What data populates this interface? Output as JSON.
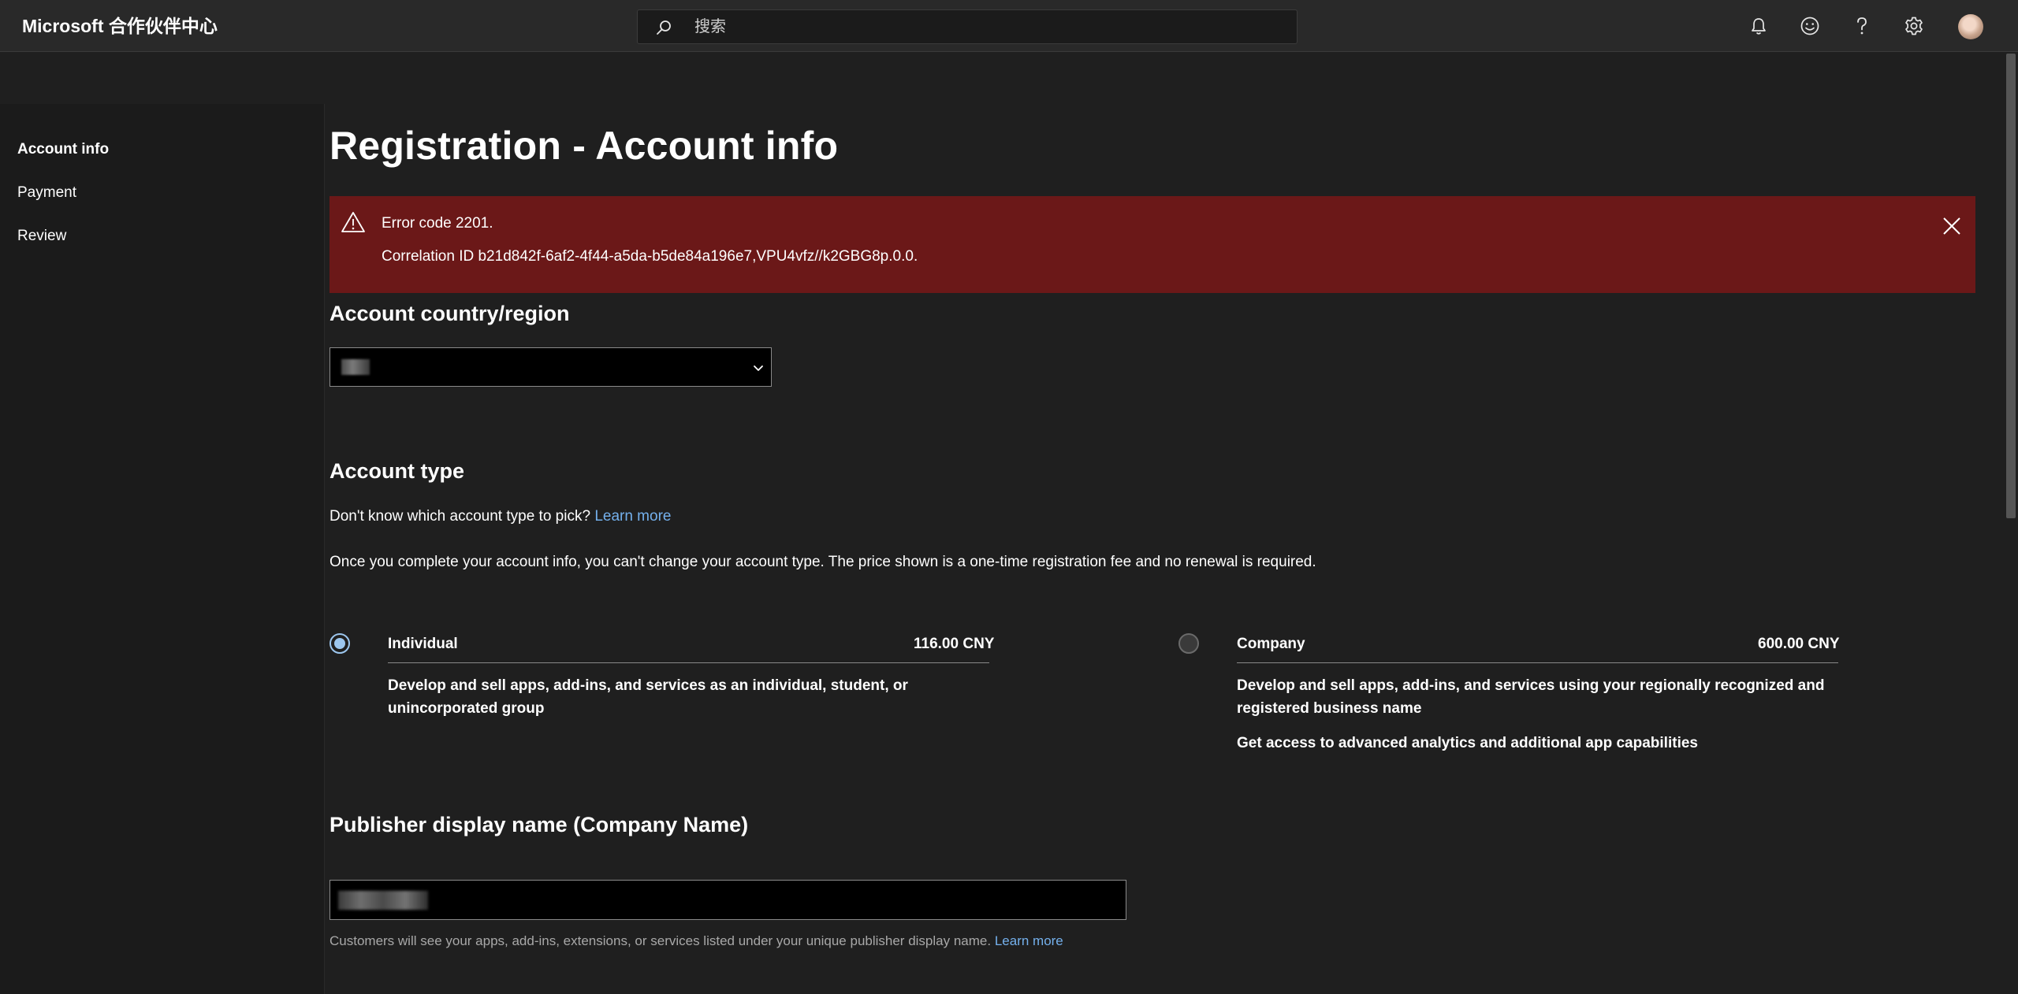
{
  "header": {
    "brand": "Microsoft 合作伙伴中心",
    "search_placeholder": "搜索",
    "icons": [
      "bell-icon",
      "smiley-icon",
      "help-icon",
      "gear-icon"
    ]
  },
  "nav": {
    "items": [
      {
        "label": "Account info",
        "active": true
      },
      {
        "label": "Payment",
        "active": false
      },
      {
        "label": "Review",
        "active": false
      }
    ]
  },
  "page": {
    "title": "Registration - Account info"
  },
  "error": {
    "line1": "Error code 2201.",
    "line2": "Correlation ID b21d842f-6af2-4f44-a5da-b5de84a196e7,VPU4vfz//k2GBG8p.0.0."
  },
  "country": {
    "heading": "Account country/region",
    "selected_value": ""
  },
  "account_type": {
    "heading": "Account type",
    "prompt": "Don't know which account type to pick?",
    "learn_more": "Learn more",
    "notice": "Once you complete your account info, you can't change your account type. The price shown is a one-time registration fee and no renewal is required.",
    "options": [
      {
        "name": "Individual",
        "price": "116.00 CNY",
        "desc1": "Develop and sell apps, add-ins, and services as an individual, student, or",
        "desc2": "unincorporated group",
        "selected": true
      },
      {
        "name": "Company",
        "price": "600.00 CNY",
        "desc1": "Develop and sell apps, add-ins, and services using your regionally recognized and",
        "desc2": "registered business name",
        "desc3": "Get access to advanced analytics and additional app capabilities",
        "selected": false
      }
    ]
  },
  "publisher": {
    "heading": "Publisher display name (Company Name)",
    "value": "",
    "helper": "Customers will see your apps, add-ins, extensions, or services listed under your unique publisher display name.",
    "learn_more": "Learn more"
  },
  "colors": {
    "error_bg": "#6b1818",
    "link": "#74b0ec",
    "radio_selected": "#9cc6ee"
  }
}
